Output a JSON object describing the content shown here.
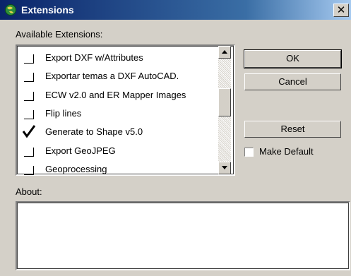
{
  "window": {
    "title": "Extensions",
    "close_glyph": "✕"
  },
  "available_label": "Available Extensions:",
  "extensions": [
    {
      "label": "Export DXF w/Attributes",
      "checked": false
    },
    {
      "label": "Exportar temas a DXF AutoCAD.",
      "checked": false
    },
    {
      "label": "ECW v2.0 and ER Mapper Images",
      "checked": false
    },
    {
      "label": "Flip lines",
      "checked": false
    },
    {
      "label": "Generate to Shape v5.0",
      "checked": true
    },
    {
      "label": "Export GeoJPEG",
      "checked": false
    },
    {
      "label": "Geoprocessing",
      "checked": false
    }
  ],
  "buttons": {
    "ok": "OK",
    "cancel": "Cancel",
    "reset": "Reset"
  },
  "make_default": {
    "label": "Make Default",
    "checked": false
  },
  "about_label": "About:",
  "about_text": "",
  "colors": {
    "dialog_bg": "#d4d0c8",
    "titlebar_start": "#0a246a",
    "titlebar_end": "#a6caf0"
  }
}
